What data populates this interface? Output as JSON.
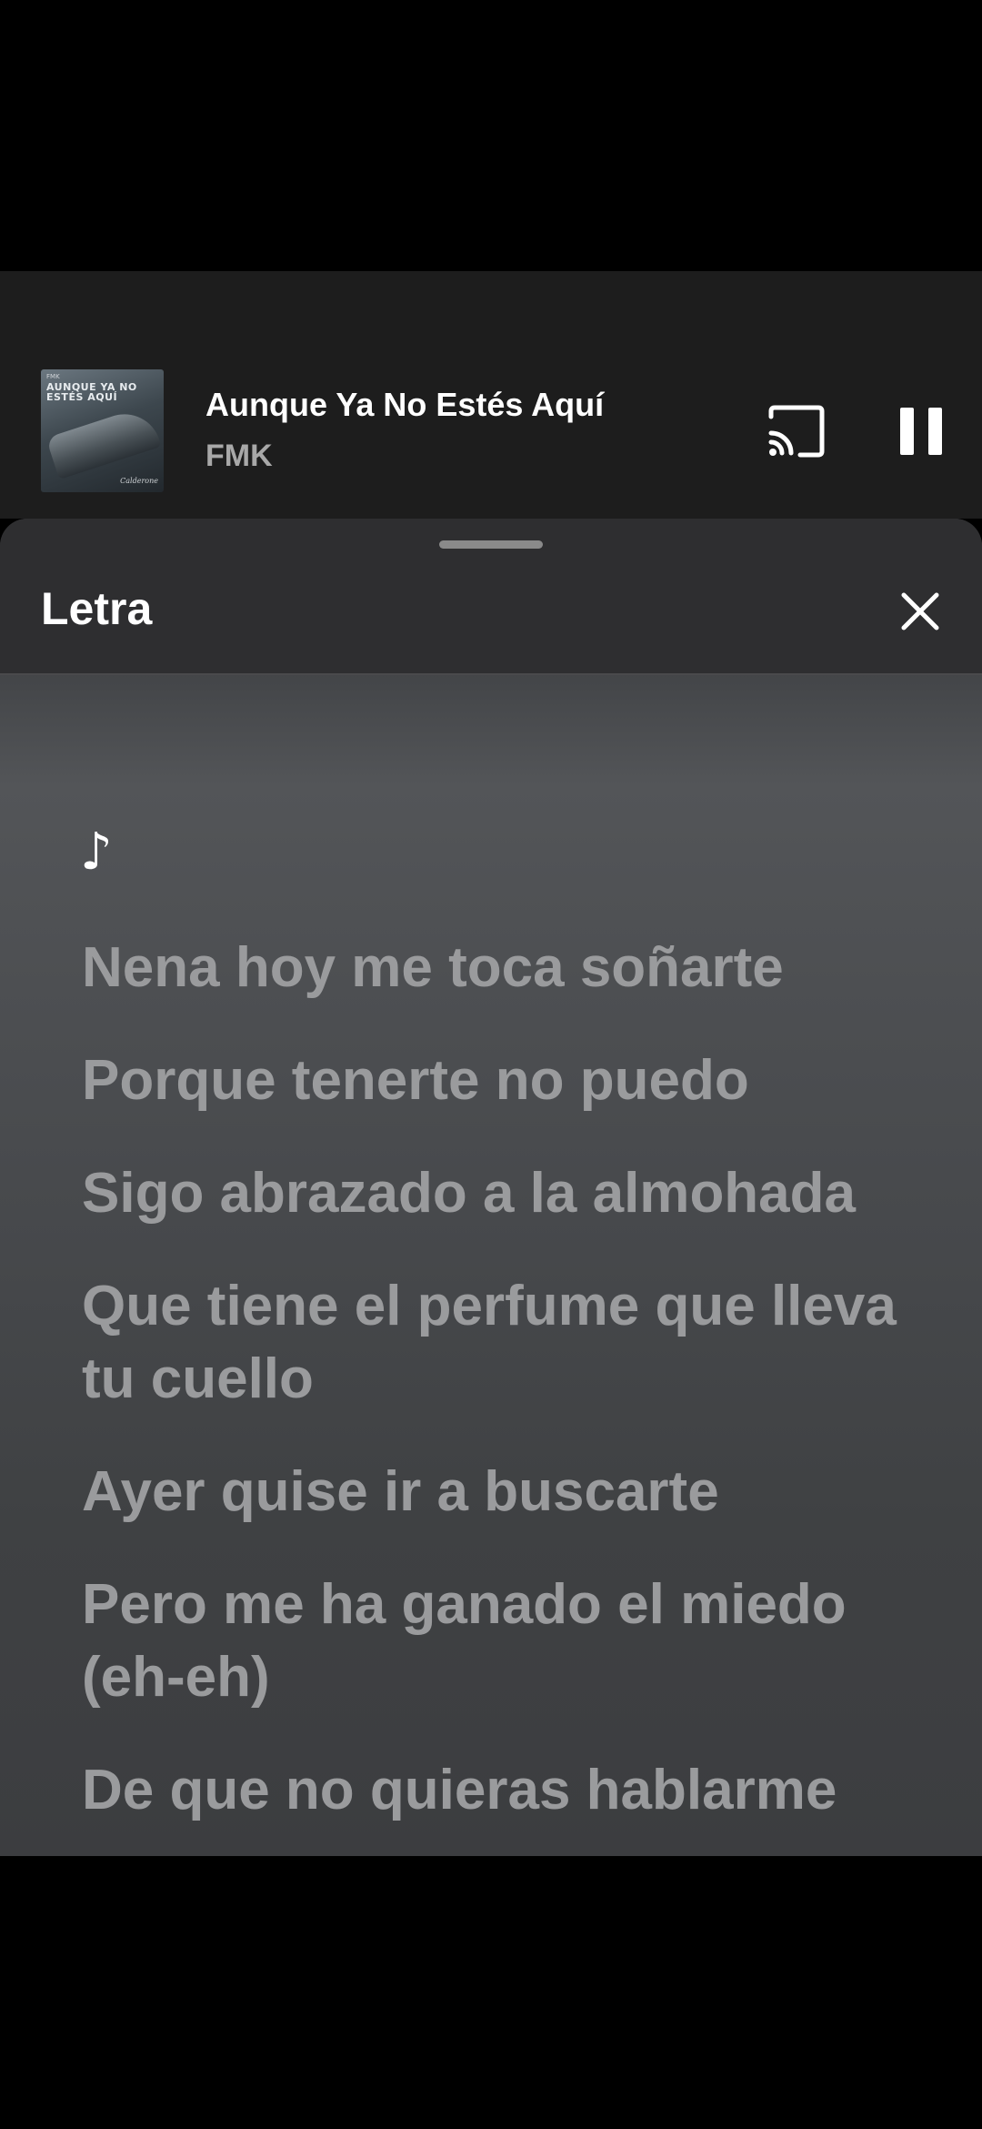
{
  "now_playing": {
    "album_art": {
      "artist_small": "FMK",
      "title_lines": "AUNQUE YA NO ESTÉS AQUÍ",
      "signature": "Calderone"
    },
    "title": "Aunque Ya No Estés Aquí",
    "artist": "FMK",
    "cast_icon": "cast-icon",
    "pause_icon": "pause-icon"
  },
  "lyrics_sheet": {
    "title": "Letra",
    "close_icon": "close-icon",
    "note_symbol": "♪",
    "lines": [
      "Nena hoy me toca soñarte",
      "Porque tenerte no puedo",
      "Sigo abrazado a la almohada",
      "Que tiene el perfume que lleva tu cuello",
      "Ayer quise ir a buscarte",
      "Pero me ha ganado el miedo (eh-eh)",
      "De que no quieras hablarme"
    ]
  },
  "colors": {
    "mini_player_bg": "#1d1d1d",
    "sheet_header_bg": "#2e2e30",
    "lyric_inactive": "#9a9b9d",
    "text_primary": "#ffffff",
    "text_secondary": "#a8a8a8"
  }
}
